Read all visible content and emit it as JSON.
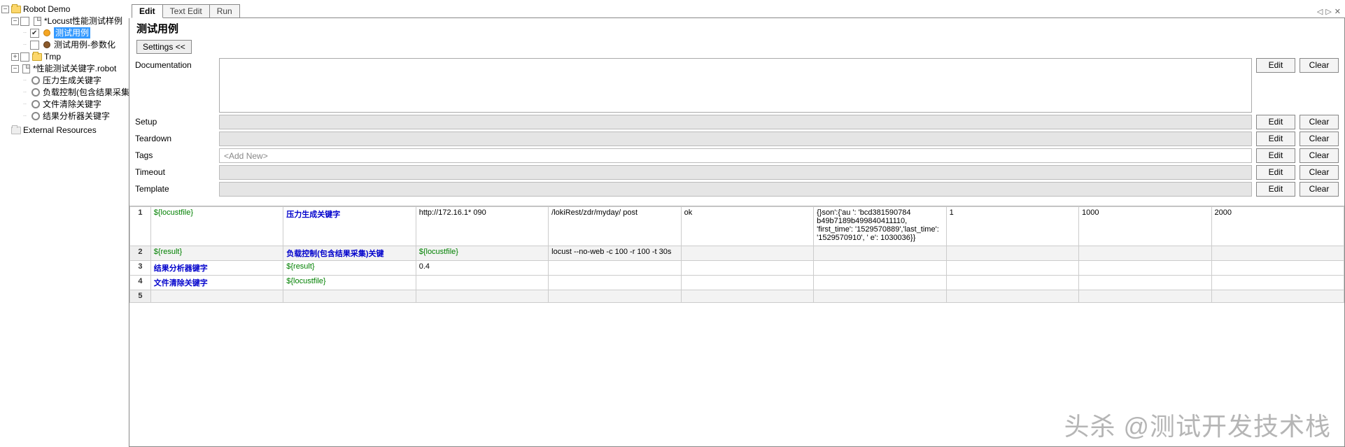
{
  "tree": {
    "root": "Robot Demo",
    "items": [
      {
        "lbl": "*Locust性能测试样例"
      },
      {
        "lbl": "测试用例",
        "selected": true
      },
      {
        "lbl": "测试用例-参数化"
      },
      {
        "lbl": "Tmp"
      },
      {
        "lbl": "*性能测试关键字.robot"
      },
      {
        "lbl": "压力生成关键字"
      },
      {
        "lbl": "负载控制(包含结果采集)关"
      },
      {
        "lbl": "文件清除关键字"
      },
      {
        "lbl": "结果分析器关键字"
      }
    ],
    "external": "External Resources"
  },
  "tabs": {
    "edit": "Edit",
    "textedit": "Text Edit",
    "run": "Run"
  },
  "editor": {
    "title": "测试用例",
    "settings_btn": "Settings <<",
    "labels": {
      "documentation": "Documentation",
      "setup": "Setup",
      "teardown": "Teardown",
      "tags": "Tags",
      "timeout": "Timeout",
      "template": "Template"
    },
    "tags_placeholder": "<Add New>",
    "btn_edit": "Edit",
    "btn_clear": "Clear"
  },
  "grid": {
    "rows": [
      {
        "n": "1",
        "c1": "${locustfile}",
        "c2": "压力生成关键字",
        "c3": "http://172.16.1*        090",
        "c4": "/lokiRest/zdr/myday/          post",
        "c5": "ok",
        "c6": "{}son':{'au         ': 'bcd381590784 b49b7189b499840411110, 'first_time': '1529570889','last_time': '1529570910', '        e': 1030036}}",
        "c7": "1",
        "c8": "1000",
        "c9": "2000"
      },
      {
        "n": "2",
        "c1": "${result}",
        "c2": "负载控制(包含结果采集)关键",
        "c3": "${locustfile}",
        "c4": "locust --no-web -c 100 -r 100 -t 30s",
        "c5": "",
        "c6": "",
        "c7": "",
        "c8": "",
        "c9": ""
      },
      {
        "n": "3",
        "c1": "结果分析器键字",
        "c2": "${result}",
        "c3": "0.4",
        "c4": "",
        "c5": "",
        "c6": "",
        "c7": "",
        "c8": "",
        "c9": ""
      },
      {
        "n": "4",
        "c1": "文件清除关键字",
        "c2": "${locustfile}",
        "c3": "",
        "c4": "",
        "c5": "",
        "c6": "",
        "c7": "",
        "c8": "",
        "c9": ""
      },
      {
        "n": "5",
        "c1": "",
        "c2": "",
        "c3": "",
        "c4": "",
        "c5": "",
        "c6": "",
        "c7": "",
        "c8": "",
        "c9": ""
      }
    ]
  },
  "watermark": "头杀 @测试开发技术栈",
  "tab_controls": {
    "prev": "◁",
    "next": "▷",
    "close": "✕"
  }
}
